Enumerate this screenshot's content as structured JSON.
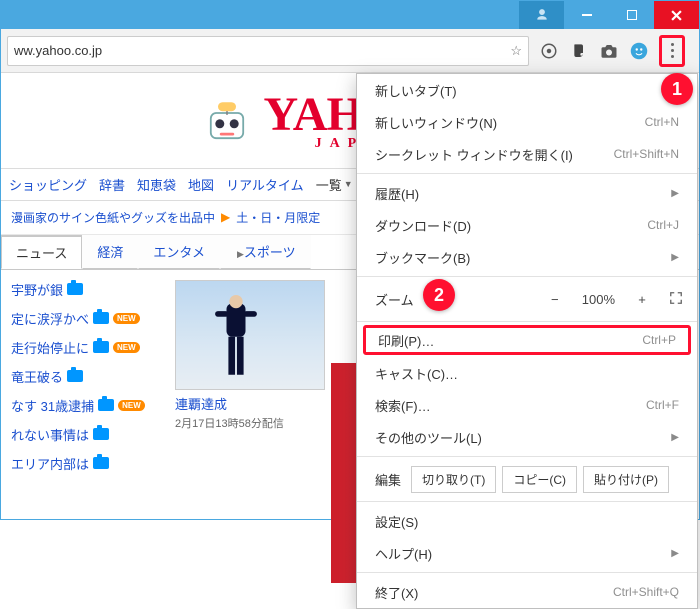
{
  "url": "ww.yahoo.co.jp",
  "logo": {
    "main": "YAHOO!",
    "sub": "JAPAN"
  },
  "nav": {
    "items": [
      "ショッピング",
      "辞書",
      "知恵袋",
      "地図",
      "リアルタイム"
    ],
    "list_label": "一覧"
  },
  "promo": {
    "left": "漫画家のサイン色紙やグッズを出品中",
    "right": "土・日・月限定"
  },
  "tabs": [
    "ニュース",
    "経済",
    "エンタメ",
    "スポーツ"
  ],
  "news": {
    "items": [
      "宇野が銀",
      "定に涙浮かべ",
      "走行始停止に",
      "竜王破る",
      "なす 31歳逮捕",
      "れない事情は",
      "エリア内部は"
    ],
    "thumb": {
      "caption": "連覇達成",
      "sub": "2月17日13時58分配信"
    }
  },
  "menu": {
    "new_tab": "新しいタブ(T)",
    "new_window": "新しいウィンドウ(N)",
    "new_window_kbd": "Ctrl+N",
    "incognito": "シークレット ウィンドウを開く(I)",
    "incognito_kbd": "Ctrl+Shift+N",
    "history": "履歴(H)",
    "downloads": "ダウンロード(D)",
    "downloads_kbd": "Ctrl+J",
    "bookmarks": "ブックマーク(B)",
    "zoom_label": "ズーム",
    "zoom_value": "100%",
    "print": "印刷(P)…",
    "print_kbd": "Ctrl+P",
    "cast": "キャスト(C)…",
    "find": "検索(F)…",
    "find_kbd": "Ctrl+F",
    "more_tools": "その他のツール(L)",
    "edit_label": "編集",
    "cut": "切り取り(T)",
    "copy": "コピー(C)",
    "paste": "貼り付け(P)",
    "settings": "設定(S)",
    "help": "ヘルプ(H)",
    "exit": "終了(X)",
    "exit_kbd": "Ctrl+Shift+Q"
  },
  "annotations": {
    "one": "1",
    "two": "2"
  }
}
